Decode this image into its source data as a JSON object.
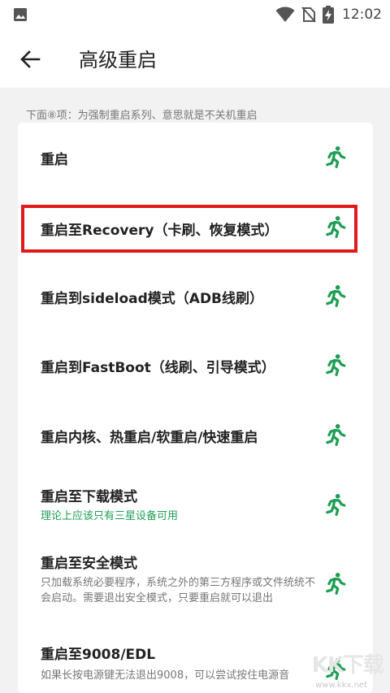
{
  "status_bar": {
    "time": "12:02"
  },
  "app_bar": {
    "title": "高级重启"
  },
  "hint": "下面⑧项：为强制重启系列、意思就是不关机重启",
  "items": [
    {
      "title": "重启",
      "subtitle": ""
    },
    {
      "title": "重启至Recovery（卡刷、恢复模式）",
      "subtitle": ""
    },
    {
      "title": "重启到sideload模式（ADB线刷）",
      "subtitle": ""
    },
    {
      "title": "重启到FastBoot（线刷、引导模式）",
      "subtitle": ""
    },
    {
      "title": "重启内核、热重启/软重启/快速重启",
      "subtitle": ""
    },
    {
      "title": "重启至下载模式",
      "subtitle": "理论上应该只有三星设备可用"
    },
    {
      "title": "重启至安全模式",
      "subtitle": "只加载系统必要程序，系统之外的第三方程序或文件统统不会启动。需要退出安全模式，只要重启就可以退出"
    },
    {
      "title": "重启至9008/EDL",
      "subtitle": "如果长按电源键无法退出9008，可以尝试按住电源音"
    }
  ],
  "watermark": {
    "logo": "KK下载",
    "url": "www.kkx.net"
  },
  "colors": {
    "accent_green": "#1e9e54",
    "highlight_red": "#e01a1a"
  },
  "icons": {
    "status_left": "image-icon",
    "run": "run-icon",
    "back": "arrow-back-icon"
  }
}
